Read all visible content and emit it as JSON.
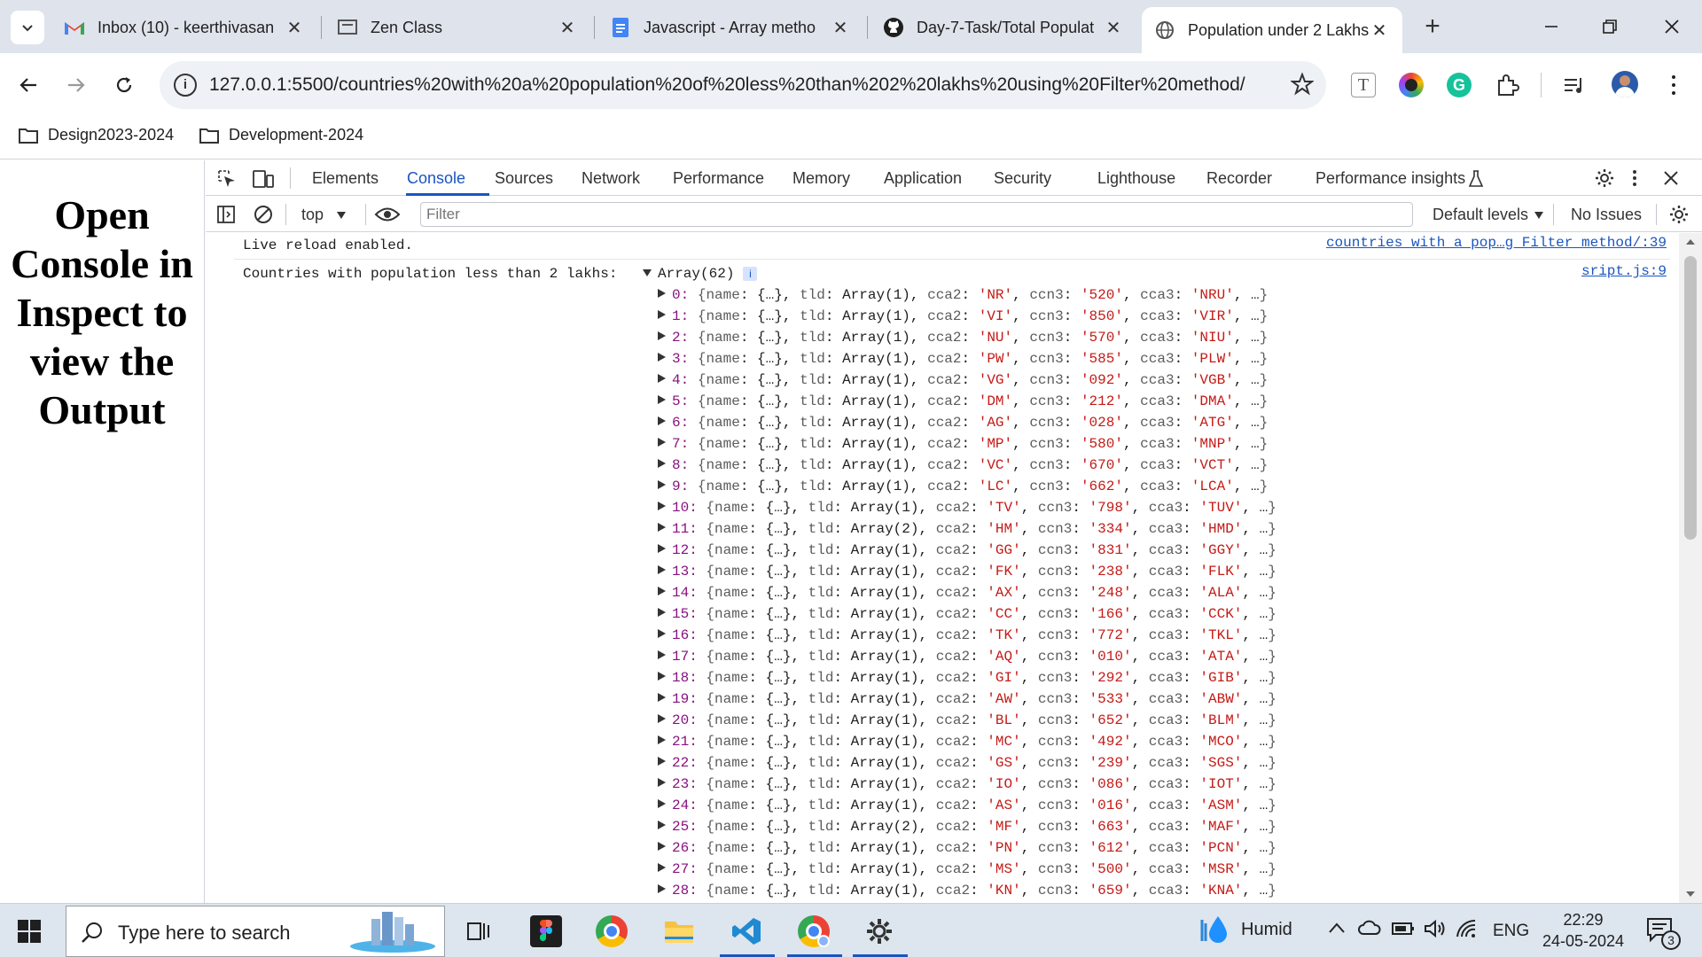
{
  "browser": {
    "tabs": [
      {
        "title": "Inbox (10) - keerthivasan",
        "icon": "gmail-icon",
        "active": false
      },
      {
        "title": "Zen Class",
        "icon": "zen-class-icon",
        "active": false
      },
      {
        "title": "Javascript - Array metho",
        "icon": "docs-icon",
        "active": false
      },
      {
        "title": "Day-7-Task/Total Populat",
        "icon": "github-icon",
        "active": false
      },
      {
        "title": "Population under 2 Lakhs",
        "icon": "globe-icon",
        "active": true
      }
    ],
    "new_tab_label": "+",
    "url": "127.0.0.1:5500/countries%20with%20a%20population%20of%20less%20than%202%20lakhs%20using%20Filter%20method/",
    "bookmarks": [
      "Design2023-2024",
      "Development-2024"
    ]
  },
  "page": {
    "heading": "Open Console in Inspect to view the Output"
  },
  "devtools": {
    "tabs": [
      "Elements",
      "Console",
      "Sources",
      "Network",
      "Performance",
      "Memory",
      "Application",
      "Security",
      "Lighthouse",
      "Recorder",
      "Performance insights"
    ],
    "active_tab": "Console",
    "context": "top",
    "filter_placeholder": "Filter",
    "levels": "Default levels",
    "issues": "No Issues",
    "log1": "Live reload enabled.",
    "log1_source": "countries with a pop…g Filter method/:39",
    "log2_label": "Countries with population less than 2 lakhs:",
    "log2_array": "Array(62)",
    "log2_source": "sript.js:9",
    "entries": [
      {
        "i": "0",
        "tld": "Array(1)",
        "cca2": "NR",
        "ccn3": "520",
        "cca3": "NRU"
      },
      {
        "i": "1",
        "tld": "Array(1)",
        "cca2": "VI",
        "ccn3": "850",
        "cca3": "VIR"
      },
      {
        "i": "2",
        "tld": "Array(1)",
        "cca2": "NU",
        "ccn3": "570",
        "cca3": "NIU"
      },
      {
        "i": "3",
        "tld": "Array(1)",
        "cca2": "PW",
        "ccn3": "585",
        "cca3": "PLW"
      },
      {
        "i": "4",
        "tld": "Array(1)",
        "cca2": "VG",
        "ccn3": "092",
        "cca3": "VGB"
      },
      {
        "i": "5",
        "tld": "Array(1)",
        "cca2": "DM",
        "ccn3": "212",
        "cca3": "DMA"
      },
      {
        "i": "6",
        "tld": "Array(1)",
        "cca2": "AG",
        "ccn3": "028",
        "cca3": "ATG"
      },
      {
        "i": "7",
        "tld": "Array(1)",
        "cca2": "MP",
        "ccn3": "580",
        "cca3": "MNP"
      },
      {
        "i": "8",
        "tld": "Array(1)",
        "cca2": "VC",
        "ccn3": "670",
        "cca3": "VCT"
      },
      {
        "i": "9",
        "tld": "Array(1)",
        "cca2": "LC",
        "ccn3": "662",
        "cca3": "LCA"
      },
      {
        "i": "10",
        "tld": "Array(1)",
        "cca2": "TV",
        "ccn3": "798",
        "cca3": "TUV"
      },
      {
        "i": "11",
        "tld": "Array(2)",
        "cca2": "HM",
        "ccn3": "334",
        "cca3": "HMD"
      },
      {
        "i": "12",
        "tld": "Array(1)",
        "cca2": "GG",
        "ccn3": "831",
        "cca3": "GGY"
      },
      {
        "i": "13",
        "tld": "Array(1)",
        "cca2": "FK",
        "ccn3": "238",
        "cca3": "FLK"
      },
      {
        "i": "14",
        "tld": "Array(1)",
        "cca2": "AX",
        "ccn3": "248",
        "cca3": "ALA"
      },
      {
        "i": "15",
        "tld": "Array(1)",
        "cca2": "CC",
        "ccn3": "166",
        "cca3": "CCK"
      },
      {
        "i": "16",
        "tld": "Array(1)",
        "cca2": "TK",
        "ccn3": "772",
        "cca3": "TKL"
      },
      {
        "i": "17",
        "tld": "Array(1)",
        "cca2": "AQ",
        "ccn3": "010",
        "cca3": "ATA"
      },
      {
        "i": "18",
        "tld": "Array(1)",
        "cca2": "GI",
        "ccn3": "292",
        "cca3": "GIB"
      },
      {
        "i": "19",
        "tld": "Array(1)",
        "cca2": "AW",
        "ccn3": "533",
        "cca3": "ABW"
      },
      {
        "i": "20",
        "tld": "Array(1)",
        "cca2": "BL",
        "ccn3": "652",
        "cca3": "BLM"
      },
      {
        "i": "21",
        "tld": "Array(1)",
        "cca2": "MC",
        "ccn3": "492",
        "cca3": "MCO"
      },
      {
        "i": "22",
        "tld": "Array(1)",
        "cca2": "GS",
        "ccn3": "239",
        "cca3": "SGS"
      },
      {
        "i": "23",
        "tld": "Array(1)",
        "cca2": "IO",
        "ccn3": "086",
        "cca3": "IOT"
      },
      {
        "i": "24",
        "tld": "Array(1)",
        "cca2": "AS",
        "ccn3": "016",
        "cca3": "ASM"
      },
      {
        "i": "25",
        "tld": "Array(2)",
        "cca2": "MF",
        "ccn3": "663",
        "cca3": "MAF"
      },
      {
        "i": "26",
        "tld": "Array(1)",
        "cca2": "PN",
        "ccn3": "612",
        "cca3": "PCN"
      },
      {
        "i": "27",
        "tld": "Array(1)",
        "cca2": "MS",
        "ccn3": "500",
        "cca3": "MSR"
      },
      {
        "i": "28",
        "tld": "Array(1)",
        "cca2": "KN",
        "ccn3": "659",
        "cca3": "KNA"
      }
    ]
  },
  "taskbar": {
    "search_placeholder": "Type here to search",
    "weather": "Humid",
    "lang": "ENG",
    "time": "22:29",
    "date": "24-05-2024",
    "notifications": "3"
  },
  "colors": {
    "accent": "#1a55c0",
    "tabstrip": "#dfe3eb",
    "taskbar": "#dde5ee"
  }
}
